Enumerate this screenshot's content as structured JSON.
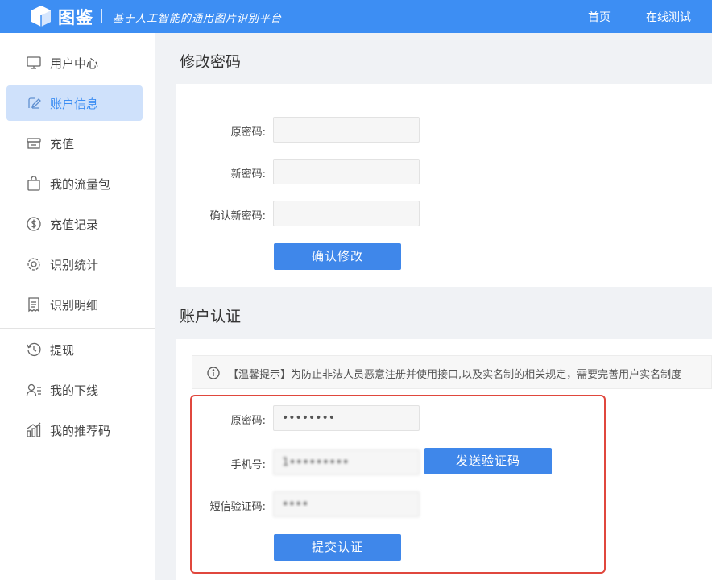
{
  "header": {
    "logo_text": "图鉴",
    "slogan": "基于人工智能的通用图片识别平台",
    "nav": [
      {
        "label": "首页"
      },
      {
        "label": "在线测试"
      }
    ]
  },
  "sidebar": {
    "items": [
      {
        "label": "用户中心",
        "icon": "monitor-icon"
      },
      {
        "label": "账户信息",
        "icon": "edit-icon",
        "active": true
      },
      {
        "label": "充值",
        "icon": "store-icon"
      },
      {
        "label": "我的流量包",
        "icon": "bag-icon"
      },
      {
        "label": "充值记录",
        "icon": "dollar-icon"
      },
      {
        "label": "识别统计",
        "icon": "gear-icon"
      },
      {
        "label": "识别明细",
        "icon": "receipt-icon"
      },
      {
        "label": "提现",
        "icon": "history-icon"
      },
      {
        "label": "我的下线",
        "icon": "user-list-icon"
      },
      {
        "label": "我的推荐码",
        "icon": "chart-icon"
      }
    ]
  },
  "change_password": {
    "title": "修改密码",
    "old_label": "原密码:",
    "new_label": "新密码:",
    "confirm_label": "确认新密码:",
    "old_value": "",
    "new_value": "",
    "confirm_value": "",
    "submit_label": "确认修改"
  },
  "verification": {
    "title": "账户认证",
    "notice": "【温馨提示】为防止非法人员恶意注册并使用接口,以及实名制的相关规定，需要完善用户实名制度",
    "password_label": "原密码:",
    "password_value": "••••••••",
    "phone_label": "手机号:",
    "phone_value": "1•••••••••",
    "send_code_label": "发送验证码",
    "sms_label": "短信验证码:",
    "sms_value": "••••",
    "submit_label": "提交认证"
  },
  "colors": {
    "brand": "#3d8ef3",
    "button": "#3f87ea",
    "highlight": "#e0473d"
  }
}
